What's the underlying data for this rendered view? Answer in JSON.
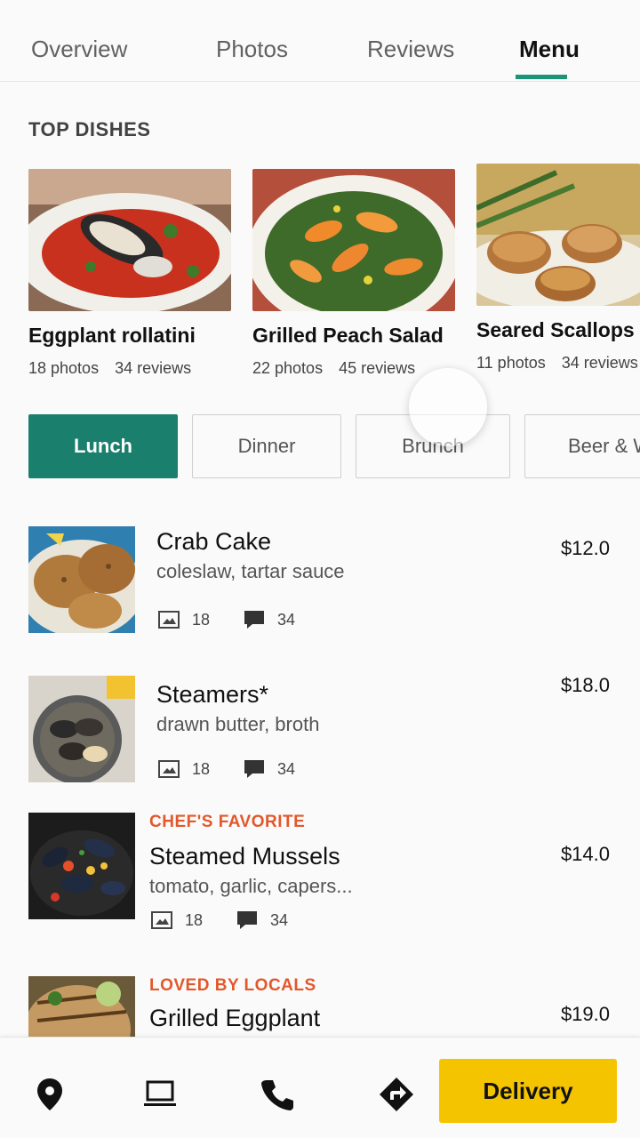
{
  "tabs": [
    {
      "label": "Overview"
    },
    {
      "label": "Photos"
    },
    {
      "label": "Reviews"
    },
    {
      "label": "Menu",
      "active": true
    }
  ],
  "top_dishes": {
    "title": "TOP DISHES",
    "items": [
      {
        "name": "Eggplant rollatini",
        "photos": "18 photos",
        "reviews": "34 reviews"
      },
      {
        "name": "Grilled Peach Salad",
        "photos": "22 photos",
        "reviews": "45 reviews"
      },
      {
        "name": "Seared Scallops",
        "photos": "11 photos",
        "reviews": "34 reviews"
      }
    ]
  },
  "filters": [
    {
      "label": "Lunch",
      "active": true
    },
    {
      "label": "Dinner"
    },
    {
      "label": "Brunch"
    },
    {
      "label": "Beer & Wine"
    }
  ],
  "menu_items": [
    {
      "tag": "",
      "name": "Crab Cake",
      "desc": "coleslaw, tartar sauce",
      "price": "$12.0",
      "photos": "18",
      "reviews": "34"
    },
    {
      "tag": "",
      "name": "Steamers*",
      "desc": "drawn butter, broth",
      "price": "$18.0",
      "photos": "18",
      "reviews": "34"
    },
    {
      "tag": "CHEF'S FAVORITE",
      "name": "Steamed Mussels",
      "desc": "tomato, garlic, capers...",
      "price": "$14.0",
      "photos": "18",
      "reviews": "34"
    },
    {
      "tag": "LOVED BY LOCALS",
      "name": "Grilled Eggplant",
      "desc": "",
      "price": "$19.0",
      "photos": "",
      "reviews": ""
    }
  ],
  "bottom_bar": {
    "icons": [
      "location-pin-icon",
      "laptop-icon",
      "phone-icon",
      "directions-icon"
    ],
    "delivery_label": "Delivery"
  },
  "colors": {
    "accent": "#1a7f6c",
    "tag": "#e2582b",
    "delivery": "#f5c400"
  }
}
